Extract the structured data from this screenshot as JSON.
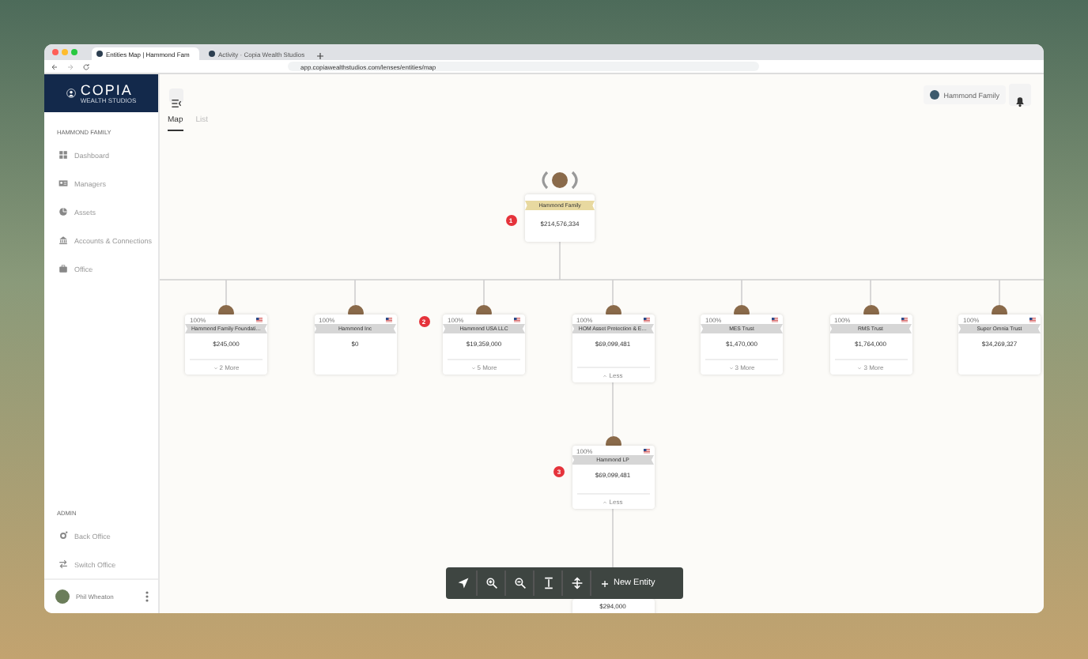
{
  "browser": {
    "tabs": [
      {
        "title": "Entities Map | Hammond Fam",
        "selected": true
      },
      {
        "title": "Activity · Copia Wealth Studios",
        "selected": false
      }
    ],
    "url": "app.copiawealthstudios.com/lenses/entities/map"
  },
  "logo": {
    "name": "COPIA",
    "tagline": "WEALTH STUDIOS"
  },
  "sidebar": {
    "section": "HAMMOND FAMILY",
    "items": [
      {
        "label": "Dashboard"
      },
      {
        "label": "Managers"
      },
      {
        "label": "Assets"
      },
      {
        "label": "Accounts & Connections"
      },
      {
        "label": "Office"
      }
    ],
    "admin_section": "ADMIN",
    "admin_items": [
      {
        "label": "Back Office"
      },
      {
        "label": "Switch Office"
      }
    ],
    "user": "Phil Wheaton"
  },
  "header": {
    "family": "Hammond Family"
  },
  "view_tabs": [
    {
      "label": "Map",
      "selected": true
    },
    {
      "label": "List",
      "selected": false
    }
  ],
  "map": {
    "root": {
      "name": "Hammond Family",
      "value": "$214,576,334",
      "badge": "1",
      "children": [
        {
          "percent": "100%",
          "name": "Hammond Family Foundati…",
          "value": "$245,000",
          "footer": {
            "label": "2 More",
            "expanded": false
          }
        },
        {
          "percent": "100%",
          "name": "Hammond Inc",
          "value": "$0"
        },
        {
          "percent": "100%",
          "name": "Hammond USA LLC",
          "value": "$19,359,000",
          "badge": "2",
          "footer": {
            "label": "5 More",
            "expanded": false
          }
        },
        {
          "percent": "100%",
          "name": "HOM Asset Protection & E…",
          "value": "$69,099,481",
          "footer": {
            "label": "Less",
            "expanded": true
          },
          "children": [
            {
              "percent": "100%",
              "name": "Hammond LP",
              "value": "$69,099,481",
              "badge": "3",
              "footer": {
                "label": "Less",
                "expanded": true
              },
              "children": [
                {
                  "value": "$294,000"
                }
              ]
            }
          ]
        },
        {
          "percent": "100%",
          "name": "MES Trust",
          "value": "$1,470,000",
          "footer": {
            "label": "3 More",
            "expanded": false
          }
        },
        {
          "percent": "100%",
          "name": "RMS Trust",
          "value": "$1,764,000",
          "footer": {
            "label": "3 More",
            "expanded": false
          }
        },
        {
          "percent": "100%",
          "name": "Super Omnia Trust",
          "value": "$34,269,327"
        }
      ]
    }
  },
  "toolbar": {
    "new_entity": "New Entity"
  }
}
